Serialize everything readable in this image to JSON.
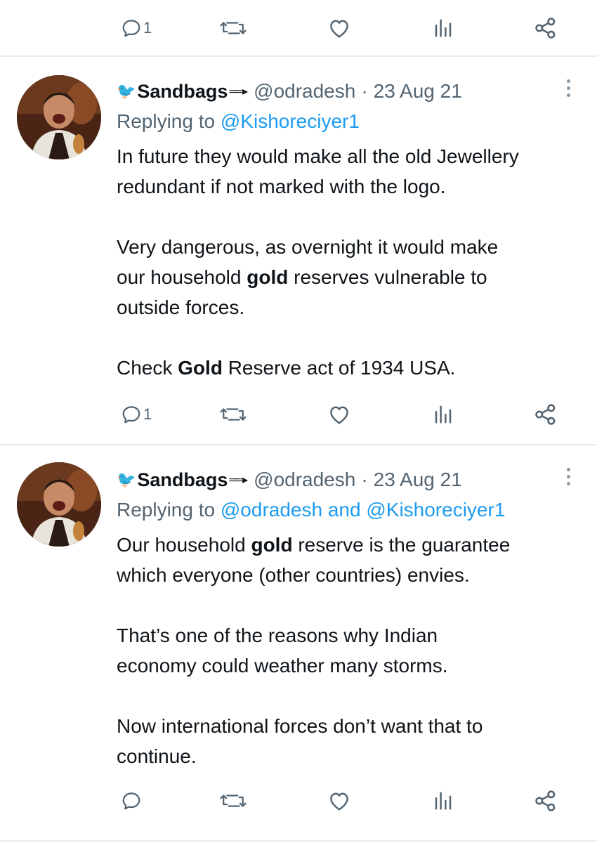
{
  "top_actions": {
    "reply_count": "1"
  },
  "tweets": [
    {
      "author": {
        "name": "Sandbags",
        "handle": "@odradesh"
      },
      "date": "23 Aug 21",
      "replying_prefix": "Replying to",
      "replying_to": [
        "@Kishoreciyer1"
      ],
      "paragraphs": [
        [
          "In future they would make all the old Jewellery",
          "redundant if not marked with the logo."
        ],
        [
          "Very dangerous, as overnight it would make",
          "our household ",
          "gold",
          " reserves vulnerable to",
          "outside forces."
        ],
        [
          "Check ",
          "Gold",
          " Reserve act of 1934 USA."
        ]
      ],
      "reply_count": "1"
    },
    {
      "author": {
        "name": "Sandbags",
        "handle": "@odradesh"
      },
      "date": "23 Aug 21",
      "replying_prefix": "Replying to",
      "replying_to": [
        "@odradesh",
        "@Kishoreciyer1"
      ],
      "replying_joiner": "and",
      "paragraphs": [
        [
          "Our household ",
          "gold",
          " reserve is the guarantee",
          "which everyone (other countries) envies."
        ],
        [
          "That’s one of the reasons why Indian",
          "economy could weather many storms."
        ],
        [
          "Now international forces don’t want that to",
          "continue."
        ]
      ],
      "reply_count": ""
    }
  ],
  "colors": {
    "text": "#0f1419",
    "muted": "#536471",
    "link": "#1d9bf0",
    "divider": "#e6ecf0"
  },
  "icons": [
    "reply-icon",
    "retweet-icon",
    "like-icon",
    "views-icon",
    "share-icon",
    "more-icon",
    "bird-icon"
  ]
}
